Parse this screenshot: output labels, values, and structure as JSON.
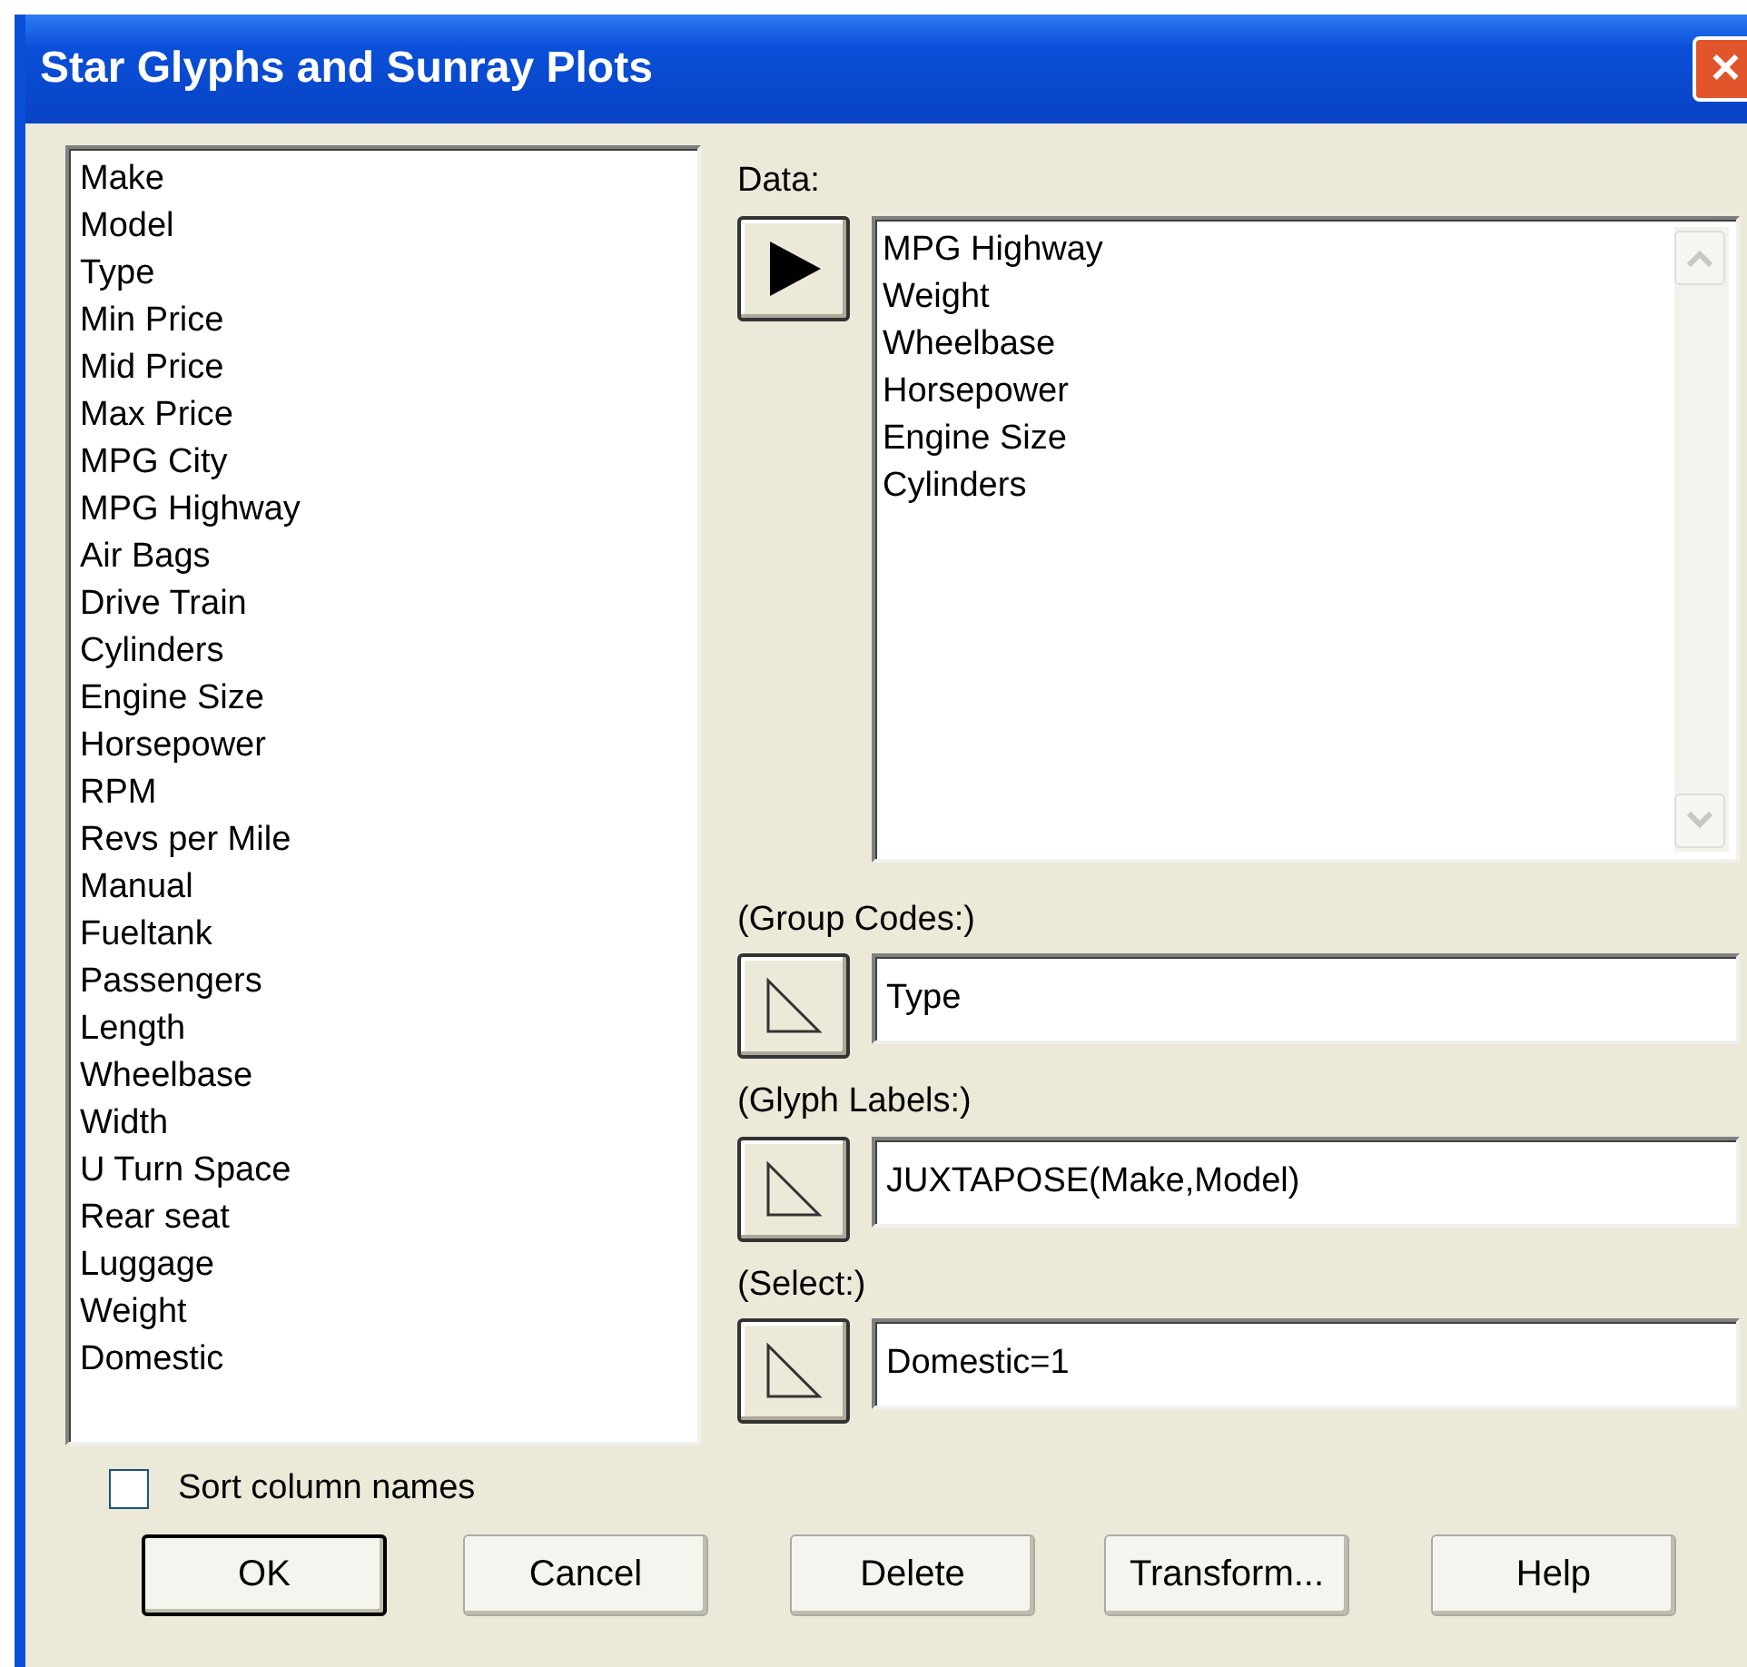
{
  "window": {
    "title": "Star Glyphs and Sunray Plots",
    "close": "✕"
  },
  "columns": [
    "Make",
    "Model",
    "Type",
    "Min Price",
    "Mid Price",
    "Max Price",
    "MPG City",
    "MPG Highway",
    "Air Bags",
    "Drive Train",
    "Cylinders",
    "Engine Size",
    "Horsepower",
    "RPM",
    "Revs per Mile",
    "Manual",
    "Fueltank",
    "Passengers",
    "Length",
    "Wheelbase",
    "Width",
    "U Turn Space",
    "Rear seat",
    "Luggage",
    "Weight",
    "Domestic"
  ],
  "inputs": [
    {
      "kind": "list",
      "label": "Data:",
      "arrow_enabled": true,
      "items": [
        "MPG Highway",
        "Weight",
        "Wheelbase",
        "Horsepower",
        "Engine Size",
        "Cylinders"
      ]
    },
    {
      "kind": "field",
      "label": "(Group Codes:)",
      "arrow_enabled": false,
      "value": "Type"
    },
    {
      "kind": "field",
      "label": "(Glyph Labels:)",
      "arrow_enabled": false,
      "value": "JUXTAPOSE(Make,Model)"
    },
    {
      "kind": "field",
      "label": "(Select:)",
      "arrow_enabled": false,
      "value": "Domestic=1"
    }
  ],
  "sort_columns": {
    "label": "Sort column names",
    "checked": false
  },
  "buttons": [
    {
      "label": "OK",
      "default": true
    },
    {
      "label": "Cancel",
      "default": false
    },
    {
      "label": "Delete",
      "default": false
    },
    {
      "label": "Transform...",
      "default": false
    },
    {
      "label": "Help",
      "default": false
    }
  ]
}
